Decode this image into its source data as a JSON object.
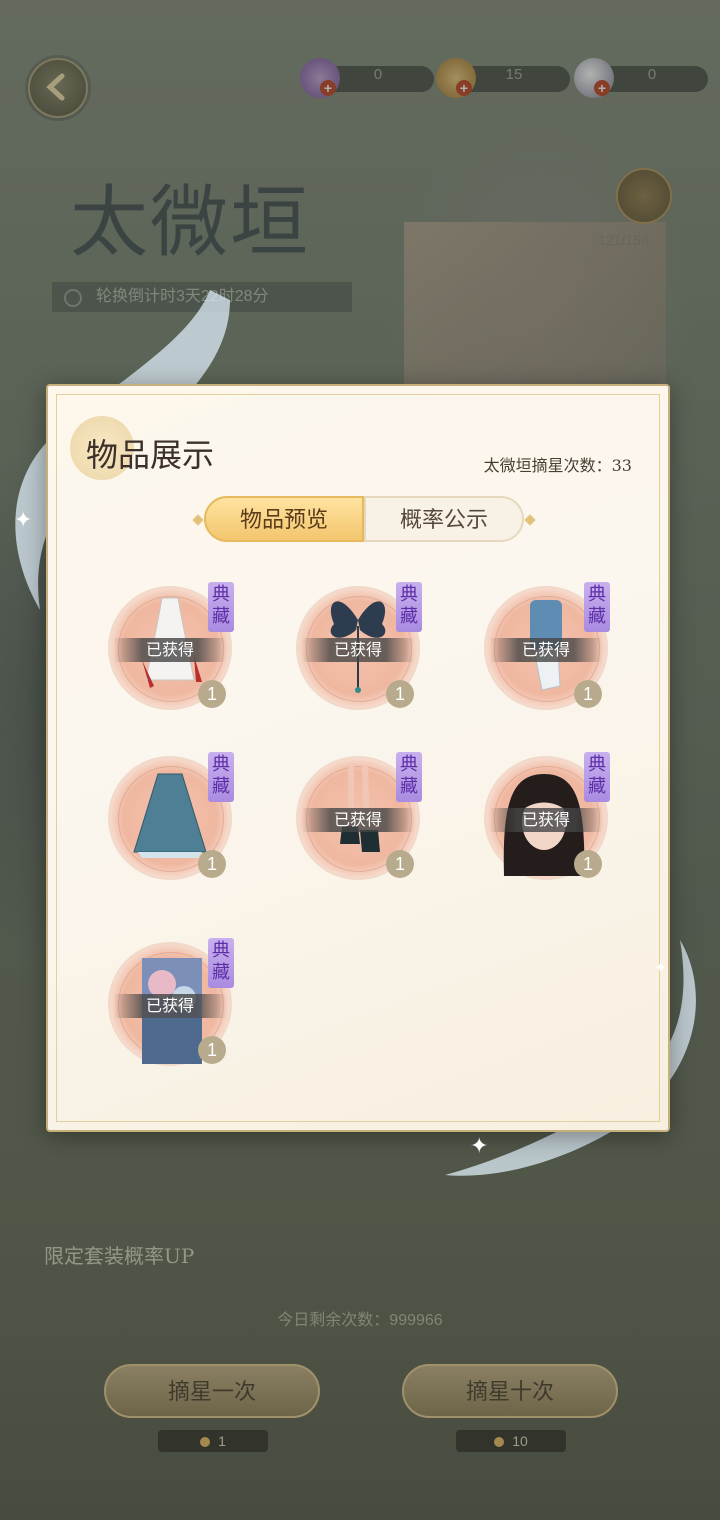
{
  "currencies": [
    {
      "icon": "character-token-icon",
      "value": "0"
    },
    {
      "icon": "gold-coin-icon",
      "value": "15"
    },
    {
      "icon": "pearl-icon",
      "value": "0"
    }
  ],
  "banner": {
    "title": "太微垣",
    "countdown": "轮换倒计时3天22时28分",
    "progress": "121/158"
  },
  "modal": {
    "title": "物品展示",
    "stat_label": "太微垣摘星次数：33",
    "tabs": [
      {
        "label": "物品预览",
        "active": true
      },
      {
        "label": "概率公示",
        "active": false
      }
    ],
    "items": [
      {
        "name": "white-dress",
        "icon": "white-gown-icon",
        "tag": "典藏",
        "status": "已获得",
        "count": "1"
      },
      {
        "name": "butterfly-hairpin",
        "icon": "butterfly-hairpin-icon",
        "tag": "典藏",
        "status": "已获得",
        "count": "1"
      },
      {
        "name": "blue-socks",
        "icon": "blue-legwarmer-icon",
        "tag": "典藏",
        "status": "已获得",
        "count": "1"
      },
      {
        "name": "blue-skirt",
        "icon": "blue-skirt-icon",
        "tag": "典藏",
        "status": "",
        "count": "1"
      },
      {
        "name": "black-shoes",
        "icon": "black-heels-icon",
        "tag": "典藏",
        "status": "已获得",
        "count": "1"
      },
      {
        "name": "black-hair",
        "icon": "long-black-hair-icon",
        "tag": "典藏",
        "status": "已获得",
        "count": "1"
      },
      {
        "name": "illustration-card",
        "icon": "illustration-card-icon",
        "tag": "典藏",
        "status": "已获得",
        "count": "1"
      }
    ]
  },
  "bottom": {
    "promo": "限定套装概率UP",
    "remaining": "今日剩余次数：999966",
    "draw_once": "摘星一次",
    "draw_ten": "摘星十次",
    "cost_once": "1",
    "cost_ten": "10"
  }
}
